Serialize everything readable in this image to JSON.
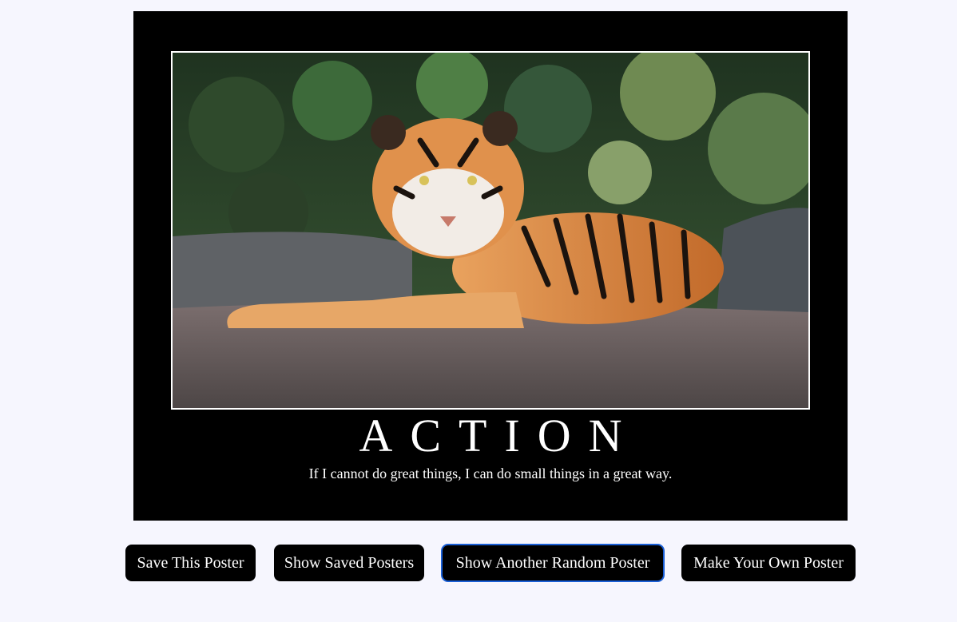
{
  "poster": {
    "image_alt": "tiger lying on a rock",
    "title": "ACTION",
    "quote": "If I cannot do great things, I can do small things in a great way."
  },
  "buttons": {
    "save": "Save This Poster",
    "show_saved": "Show Saved Posters",
    "random": "Show Another Random Poster",
    "make_own": "Make Your Own Poster"
  }
}
